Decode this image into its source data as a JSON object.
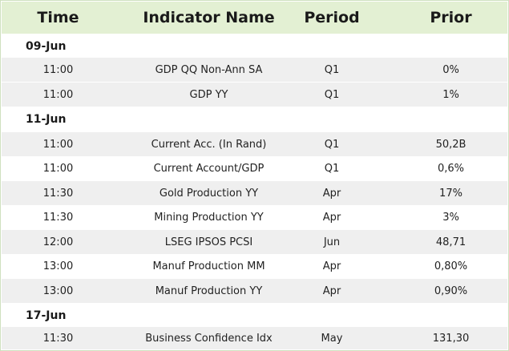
{
  "header": {
    "time": "Time",
    "name": "Indicator Name",
    "period": "Period",
    "prior": "Prior"
  },
  "groups": [
    {
      "date": "09-Jun",
      "rows": [
        {
          "time": "11:00",
          "name": "GDP QQ Non-Ann SA",
          "period": "Q1",
          "prior": "0%"
        },
        {
          "time": "11:00",
          "name": "GDP YY",
          "period": "Q1",
          "prior": "1%"
        }
      ]
    },
    {
      "date": "11-Jun",
      "rows": [
        {
          "time": "11:00",
          "name": "Current Acc. (In Rand)",
          "period": "Q1",
          "prior": "50,2B"
        },
        {
          "time": "11:00",
          "name": "Current Account/GDP",
          "period": "Q1",
          "prior": "0,6%"
        },
        {
          "time": "11:30",
          "name": "Gold Production YY",
          "period": "Apr",
          "prior": "17%"
        },
        {
          "time": "11:30",
          "name": "Mining Production YY",
          "period": "Apr",
          "prior": "3%"
        },
        {
          "time": "12:00",
          "name": "LSEG IPSOS PCSI",
          "period": "Jun",
          "prior": "48,71"
        },
        {
          "time": "13:00",
          "name": "Manuf Production MM",
          "period": "Apr",
          "prior": "0,80%"
        },
        {
          "time": "13:00",
          "name": "Manuf Production YY",
          "period": "Apr",
          "prior": "0,90%"
        }
      ]
    },
    {
      "date": "17-Jun",
      "rows": [
        {
          "time": "11:30",
          "name": "Business Confidence Idx",
          "period": "May",
          "prior": "131,30"
        }
      ]
    }
  ],
  "colors": {
    "header_bg": "#e3f0d3",
    "shaded_row": "#efefef",
    "border": "#cfe0bf"
  }
}
